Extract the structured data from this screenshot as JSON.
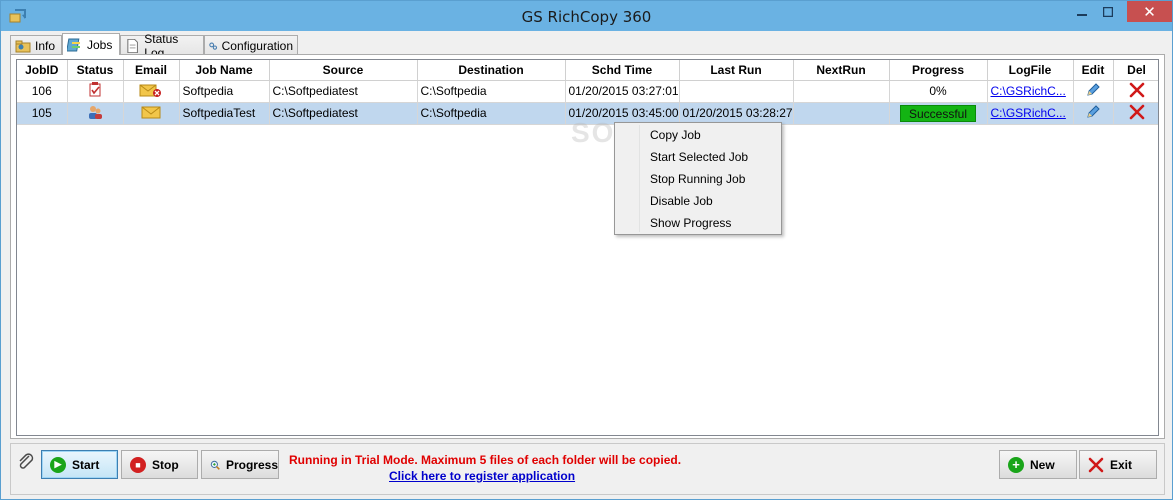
{
  "window": {
    "title": "GS RichCopy 360"
  },
  "tabs": [
    {
      "label": "Info",
      "icon": "info-folder-icon"
    },
    {
      "label": "Jobs",
      "icon": "jobs-icon"
    },
    {
      "label": "Status Log",
      "icon": "document-icon"
    },
    {
      "label": "Configuration",
      "icon": "gears-icon"
    }
  ],
  "grid": {
    "columns": [
      "JobID",
      "Status",
      "Email",
      "Job Name",
      "Source",
      "Destination",
      "Schd Time",
      "Last Run",
      "NextRun",
      "Progress",
      "LogFile",
      "Edit",
      "Del"
    ],
    "rows": [
      {
        "job_id": "106",
        "status_icon": "clipboard-check-icon",
        "email_icon": "email-error-icon",
        "job_name": "Softpedia",
        "source": "C:\\Softpediatest",
        "destination": "C:\\Softpedia",
        "schd_time": "01/20/2015 03:27:01",
        "last_run": "",
        "next_run": "",
        "progress": "0%",
        "logfile": "C:\\GSRichC...",
        "selected": false
      },
      {
        "job_id": "105",
        "status_icon": "users-icon",
        "email_icon": "email-icon",
        "job_name": "SoftpediaTest",
        "source": "C:\\Softpediatest",
        "destination": "C:\\Softpedia",
        "schd_time": "01/20/2015 03:45:00",
        "last_run": "01/20/2015 03:28:27",
        "next_run": "",
        "progress": "Successful",
        "logfile": "C:\\GSRichC...",
        "selected": true
      }
    ]
  },
  "context_menu": {
    "items": [
      "Copy Job",
      "Start Selected Job",
      "Stop Running Job",
      "Disable Job",
      "Show Progress"
    ]
  },
  "watermark": "SOFTPEDIA",
  "bottombar": {
    "start_label": "Start",
    "stop_label": "Stop",
    "progress_label": "Progress",
    "trial_message": "Running in Trial Mode. Maximum 5 files of each folder will be copied.",
    "register_link": "Click here to register application",
    "new_label": "New",
    "exit_label": "Exit"
  },
  "colors": {
    "titlebar": "#6ab2e3",
    "close_button": "#c75050",
    "selected_row": "#c0d7ee",
    "success_green": "#13b413",
    "trial_red": "#e00000",
    "link_blue": "#0000cc"
  }
}
